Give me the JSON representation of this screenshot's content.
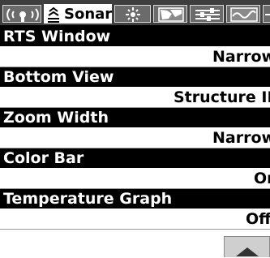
{
  "tabs": [
    {
      "label": "",
      "icon": "speaker-icon"
    },
    {
      "label": "Sonar",
      "icon": "sonar-icon",
      "active": true
    },
    {
      "label": "",
      "icon": "sun-icon"
    },
    {
      "label": "",
      "icon": "chart-icon"
    },
    {
      "label": "",
      "icon": "settings-icon"
    },
    {
      "label": "",
      "icon": "waves-icon"
    },
    {
      "label": "",
      "icon": "plus-icon"
    }
  ],
  "menu": {
    "items": [
      {
        "label": "RTS Window",
        "value": "Narrow"
      },
      {
        "label": "Bottom View",
        "value": "Structure ID"
      },
      {
        "label": "Zoom Width",
        "value": "Narrow"
      },
      {
        "label": "Color Bar",
        "value": "On"
      },
      {
        "label": "Temperature Graph",
        "value": "Off"
      }
    ]
  },
  "colors": {
    "highlight": "#000000",
    "background": "#ffffff",
    "tab_bar": "#3e3e3e"
  }
}
